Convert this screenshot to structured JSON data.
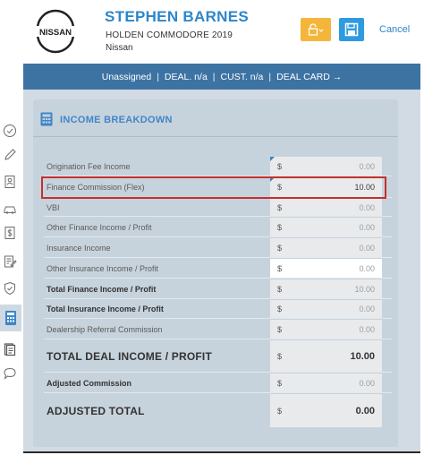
{
  "header": {
    "logo_text": "NISSAN",
    "customer_name": "STEPHEN BARNES",
    "vehicle": "HOLDEN COMMODORE 2019",
    "make": "Nissan",
    "cancel_label": "Cancel",
    "lock_icon": "lock-icon",
    "save_icon": "save-icon"
  },
  "deal_bar": {
    "status": "Unassigned",
    "deal": "DEAL. n/a",
    "cust": "CUST. n/a",
    "deal_card": "DEAL CARD →",
    "separator": "|"
  },
  "sidebar": {
    "items": [
      {
        "icon": "check-circle-icon"
      },
      {
        "icon": "pencil-icon"
      },
      {
        "icon": "person-doc-icon"
      },
      {
        "icon": "car-icon"
      },
      {
        "icon": "dollar-doc-icon"
      },
      {
        "icon": "edit-doc-icon"
      },
      {
        "icon": "shield-check-icon"
      },
      {
        "icon": "calculator-icon",
        "active": true
      },
      {
        "icon": "documents-icon"
      },
      {
        "icon": "chat-bubble-icon"
      }
    ]
  },
  "income": {
    "title": "INCOME BREAKDOWN",
    "currency": "$",
    "rows": [
      {
        "label": "Origination Fee Income",
        "value": "0.00"
      },
      {
        "label": "Finance Commission (Flex)",
        "value": "10.00"
      },
      {
        "label": "VBI",
        "value": "0.00"
      },
      {
        "label": "Other Finance Income / Profit",
        "value": "0.00"
      },
      {
        "label": "Insurance Income",
        "value": "0.00"
      },
      {
        "label": "Other Insurance Income / Profit",
        "value": "0.00"
      },
      {
        "label": "Total Finance Income / Profit",
        "value": "10.00"
      },
      {
        "label": "Total Insurance Income / Profit",
        "value": "0.00"
      },
      {
        "label": "Dealership Referral Commission",
        "value": "0.00"
      },
      {
        "label": "TOTAL DEAL INCOME / PROFIT",
        "value": "10.00"
      },
      {
        "label": "Adjusted Commission",
        "value": "0.00"
      },
      {
        "label": "ADJUSTED TOTAL",
        "value": "0.00"
      }
    ]
  },
  "colors": {
    "accent": "#2e86c9",
    "deal_bar": "#3d73a3",
    "lock_button": "#f4b63a",
    "save_button": "#2e9ae0",
    "highlight": "#c4302b"
  }
}
